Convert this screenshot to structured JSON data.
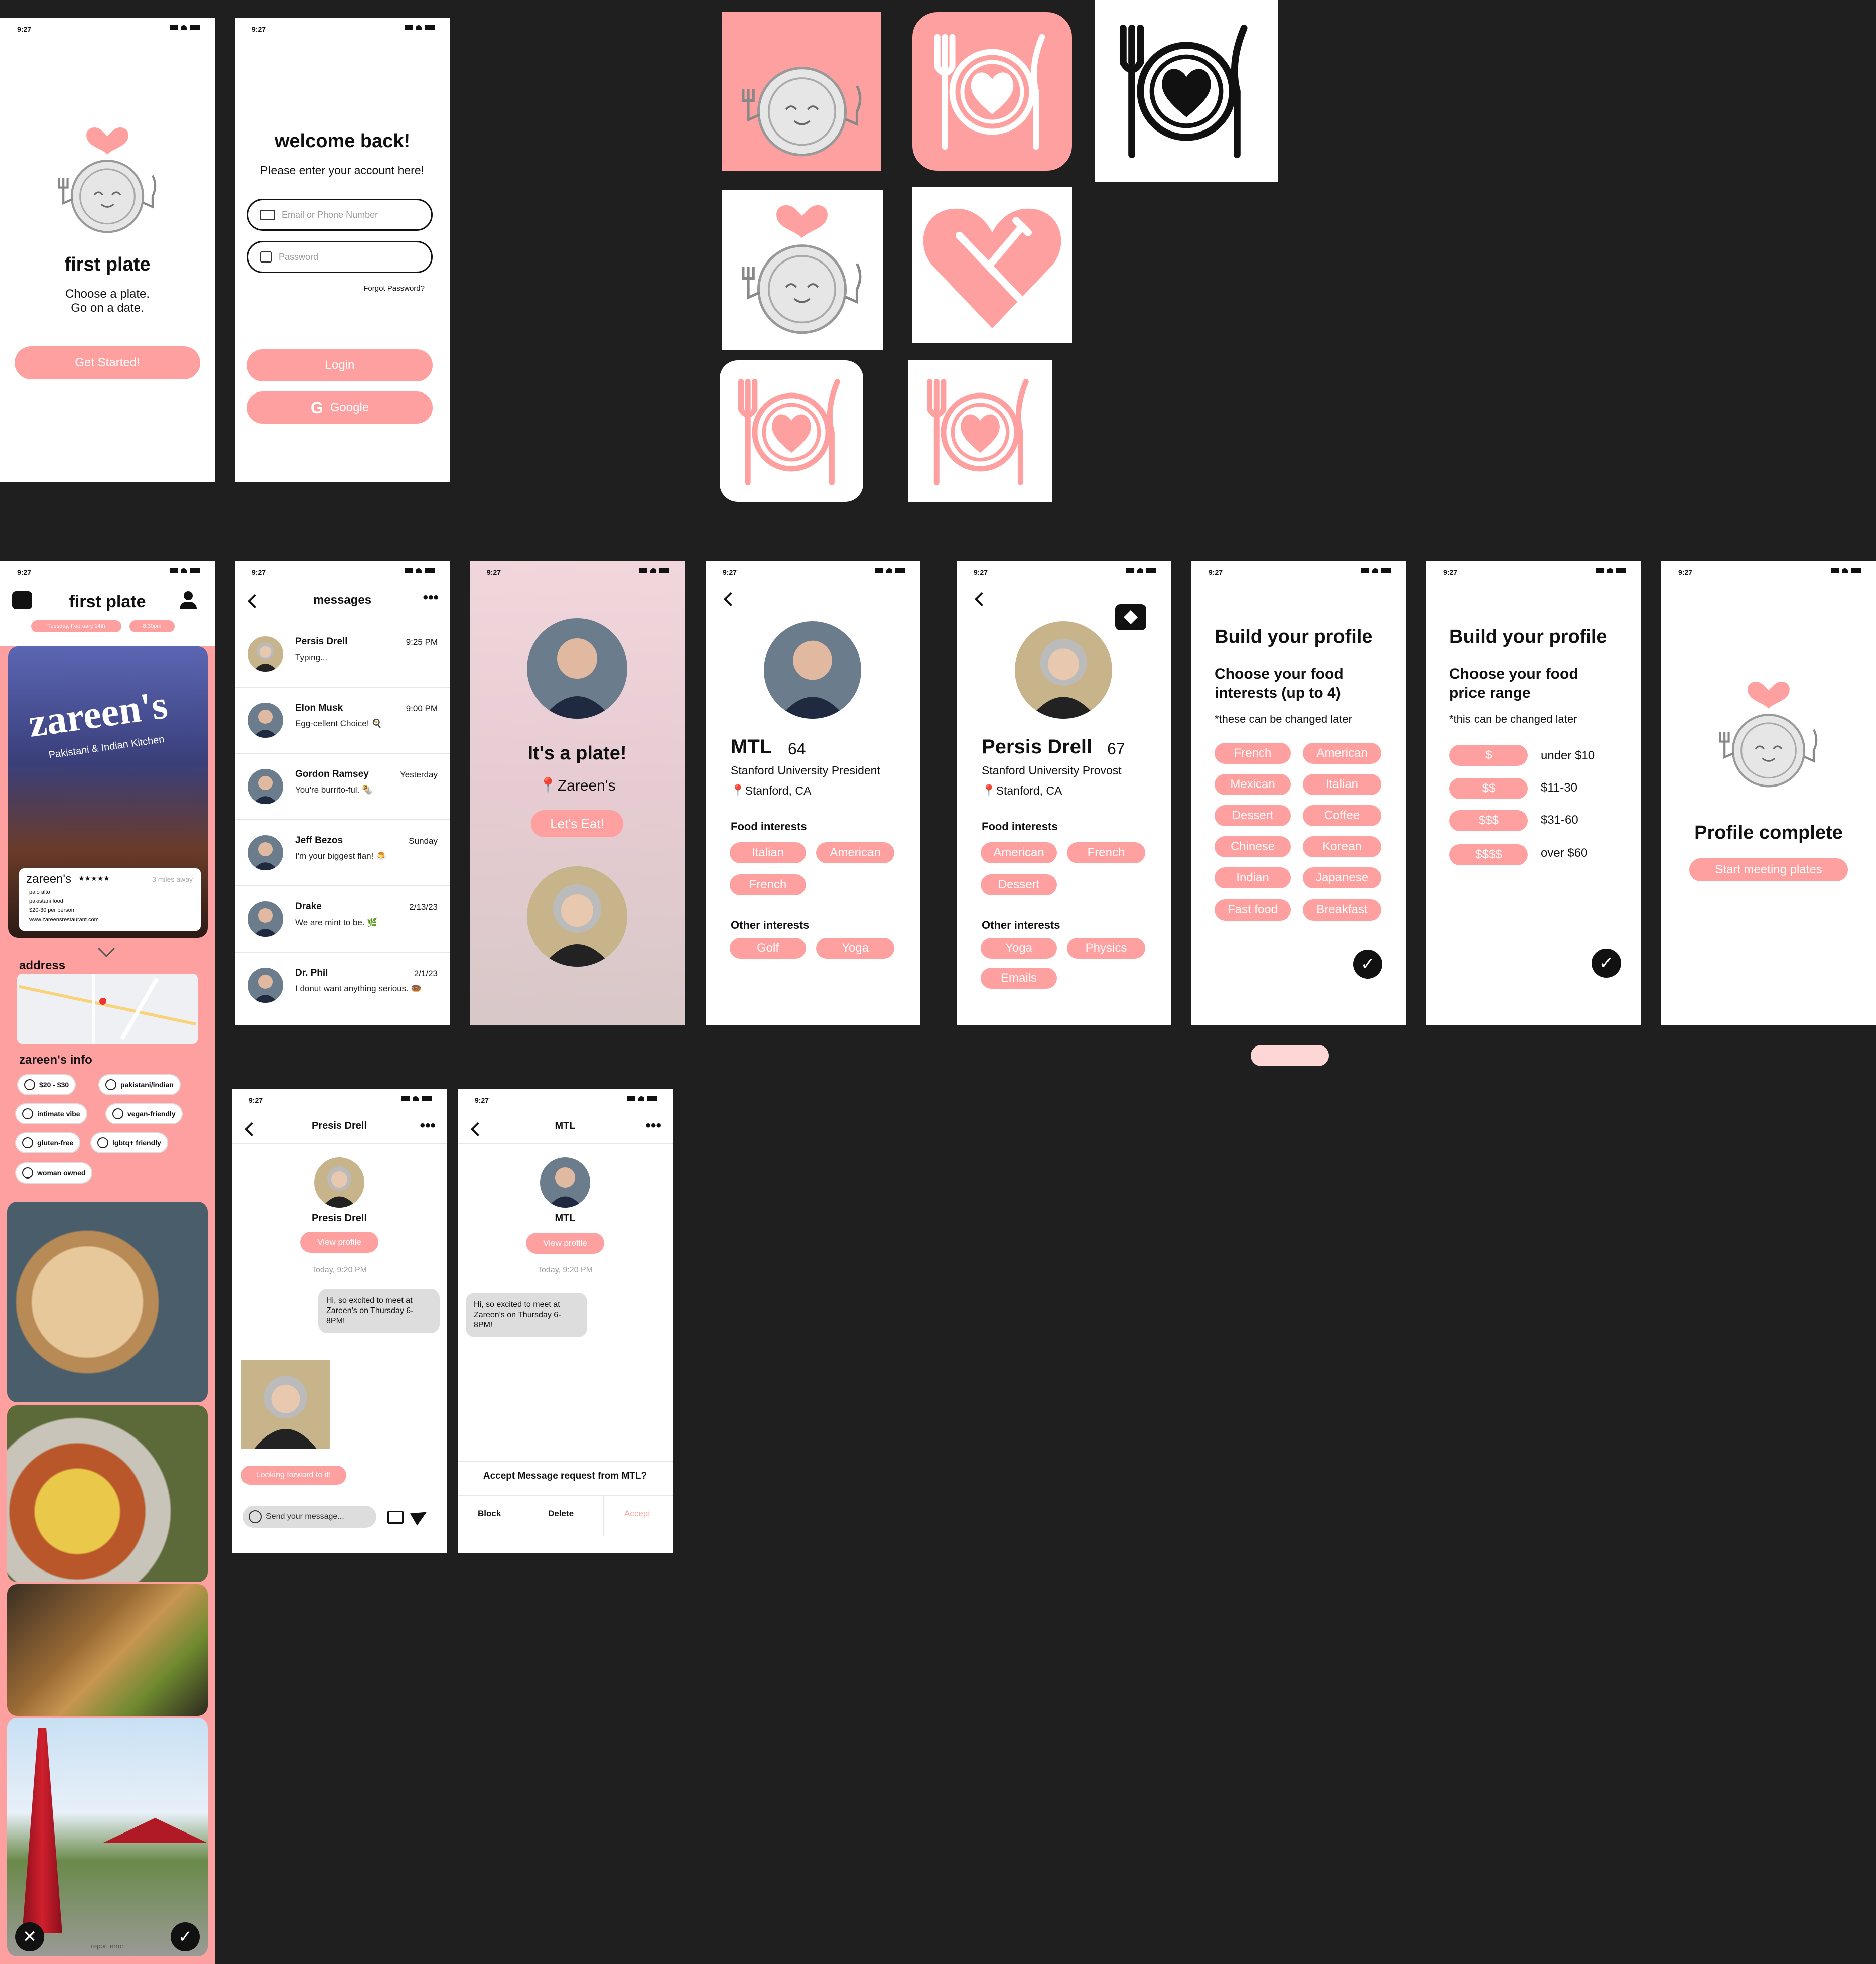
{
  "status": {
    "time": "9:27"
  },
  "colors": {
    "primary": "#FFA0A0",
    "primary_light": "#FFD6D6",
    "background": "#1F1F1F"
  },
  "splash": {
    "title": "first plate",
    "tagline1": "Choose a plate.",
    "tagline2": "Go on a date.",
    "cta": "Get Started!"
  },
  "login": {
    "title": "welcome back!",
    "subtitle": "Please enter your account here!",
    "email_placeholder": "Email or Phone Number",
    "password_placeholder": "Password",
    "forgot": "Forgot Password?",
    "login_btn": "Login",
    "google_btn": "Google"
  },
  "feed": {
    "title": "first plate",
    "date_pill": "Tuesday, February 14th",
    "time_pill": "8:30pm",
    "restaurant": "zareen's",
    "sign_line1": "zareen's",
    "sign_line2": "Pakistani & Indian Kitchen",
    "stars": "★★★★★",
    "distance": "3 miles away",
    "line1": "palo alto",
    "line2": "pakistani food",
    "line3": "$20-30 per person",
    "line4": "www.zareensrestaurant.com",
    "address_label": "address",
    "info_label": "zareen's info",
    "chips": [
      "$20 - $30",
      "pakistani/indian",
      "intimate vibe",
      "vegan-friendly",
      "gluten-free",
      "lgbtq+ friendly",
      "woman owned"
    ],
    "report": "report error"
  },
  "messages": {
    "title": "messages",
    "items": [
      {
        "name": "Persis Drell",
        "preview": "Typing...",
        "time": "9:25 PM"
      },
      {
        "name": "Elon Musk",
        "preview": "Egg-cellent Choice! 🍳",
        "time": "9:00 PM"
      },
      {
        "name": "Gordon Ramsey",
        "preview": "You're burrito-ful. 🌯",
        "time": "Yesterday"
      },
      {
        "name": "Jeff Bezos",
        "preview": "I'm your biggest flan! 🍮",
        "time": "Sunday"
      },
      {
        "name": "Drake",
        "preview": "We are mint to be. 🌿",
        "time": "2/13/23"
      },
      {
        "name": "Dr. Phil",
        "preview": "I donut want anything serious. 🍩",
        "time": "2/1/23"
      }
    ]
  },
  "match": {
    "title": "It's a plate!",
    "place": "Zareen's",
    "cta": "Let's Eat!"
  },
  "profile_mtl": {
    "name": "MTL",
    "age": "64",
    "role": "Stanford University President",
    "location": "Stanford, CA",
    "food_label": "Food interests",
    "food": [
      "Italian",
      "American",
      "French"
    ],
    "other_label": "Other interests",
    "other": [
      "Golf",
      "Yoga"
    ]
  },
  "profile_persis": {
    "name": "Persis Drell",
    "age": "67",
    "role": "Stanford University Provost",
    "location": "Stanford, CA",
    "food_label": "Food interests",
    "food": [
      "American",
      "French",
      "Dessert"
    ],
    "other_label": "Other interests",
    "other": [
      "Yoga",
      "Physics",
      "Emails"
    ]
  },
  "build1": {
    "title": "Build your profile",
    "subtitle": "Choose your food interests (up to 4)",
    "note": "*these can be changed later",
    "options": [
      "French",
      "American",
      "Mexican",
      "Italian",
      "Dessert",
      "Coffee",
      "Chinese",
      "Korean",
      "Indian",
      "Japanese",
      "Fast food",
      "Breakfast"
    ]
  },
  "build2": {
    "title": "Build your profile",
    "subtitle": "Choose your food price range",
    "note": "*this can be changed later",
    "options": [
      {
        "tag": "$",
        "label": "under $10"
      },
      {
        "tag": "$$",
        "label": "$11-30"
      },
      {
        "tag": "$$$",
        "label": "$31-60"
      },
      {
        "tag": "$$$$",
        "label": "over $60"
      }
    ]
  },
  "complete": {
    "title": "Profile complete",
    "cta": "Start meeting plates"
  },
  "chat": {
    "header": "Presis Drell",
    "name": "Presis Drell",
    "view": "View profile",
    "timestamp": "Today, 9:20 PM",
    "msg": "Hi, so excited to meet at Zareen's on Thursday 6-8PM!",
    "reply": "Looking forward to it!",
    "input_placeholder": "Send your message..."
  },
  "request": {
    "header": "MTL",
    "name": "MTL",
    "view": "View profile",
    "timestamp": "Today, 9:20 PM",
    "msg": "Hi, so excited to meet at Zareen's on Thursday 6-8PM!",
    "question": "Accept Message request from MTL?",
    "block": "Block",
    "delete": "Delete",
    "accept": "Accept"
  }
}
